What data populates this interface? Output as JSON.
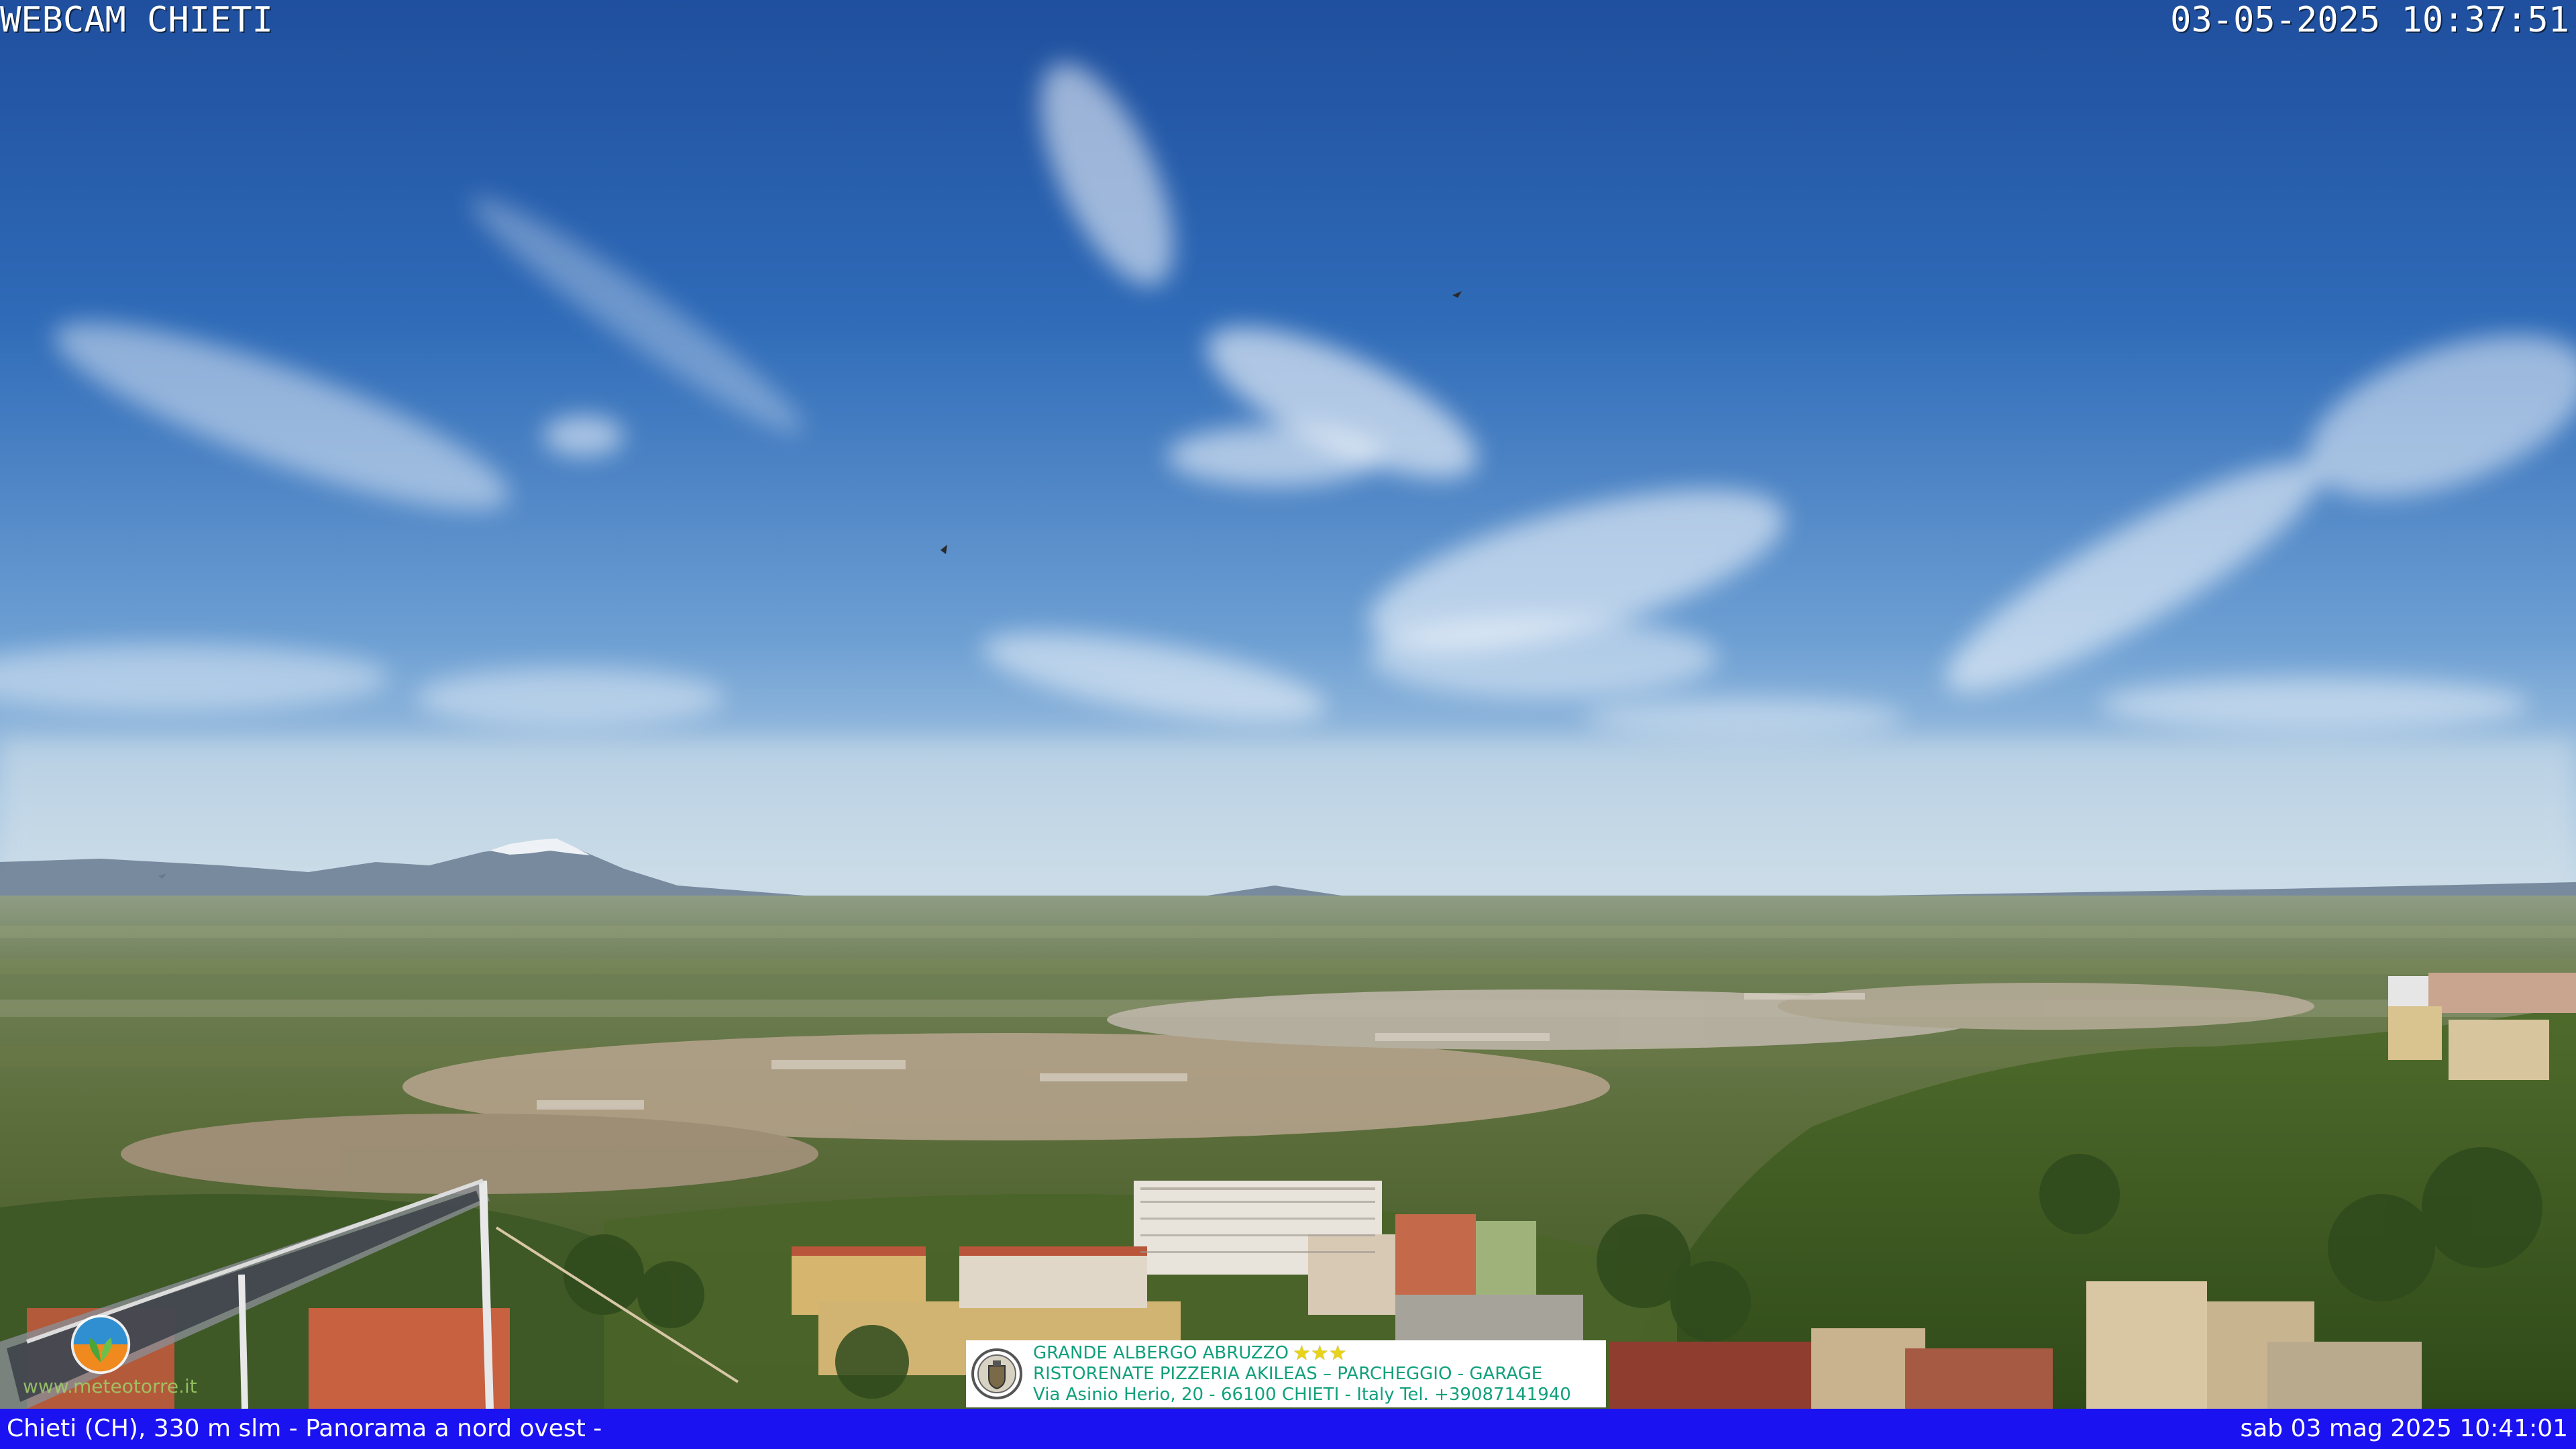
{
  "overlay": {
    "title": "WEBCAM CHIETI",
    "timestamp": "03-05-2025 10:37:51"
  },
  "status_bar": {
    "location": "Chieti (CH), 330 m slm - Panorama a nord ovest -",
    "datetime": "sab 03 mag 2025 10:41:01",
    "background_color": "#1b12f2"
  },
  "ad_banner": {
    "line1": "GRANDE ALBERGO ABRUZZO",
    "stars": "★★★",
    "line2": "RISTORENATE PIZZERIA AKILEAS – PARCHEGGIO - GARAGE",
    "line3": "Via Asinio Herio, 20 - 66100 CHIETI - Italy Tel. +39087141940",
    "text_color": "#12a07c",
    "logo_icon": "coat-of-arms-icon"
  },
  "site_logo": {
    "text": "www.meteotorre.it",
    "icon": "meteo-logo-icon"
  }
}
